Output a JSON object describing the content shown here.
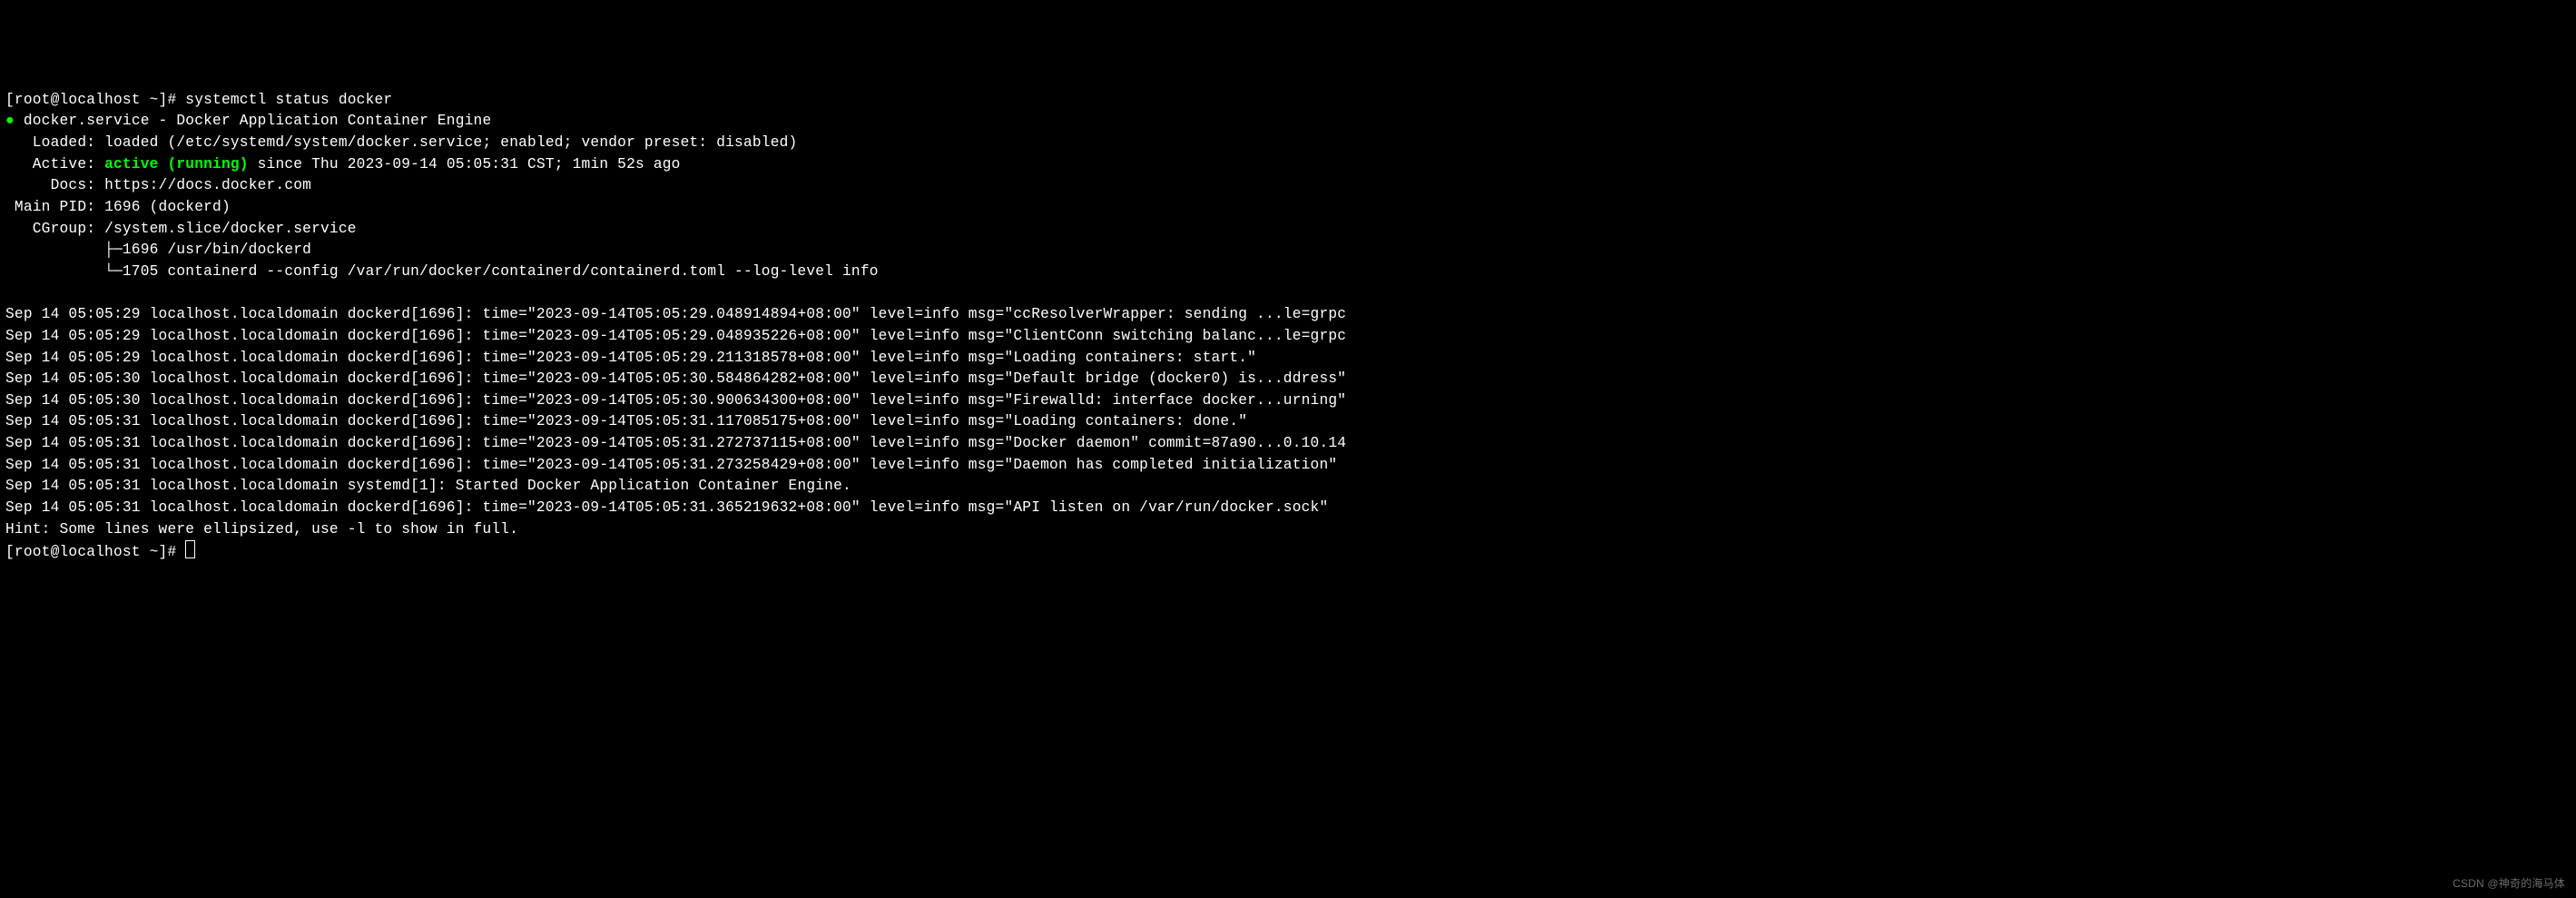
{
  "prompt1": "[root@localhost ~]# ",
  "command": "systemctl status docker",
  "service": {
    "bullet": "●",
    "name": "docker.service - Docker Application Container Engine",
    "loaded_label": "   Loaded: ",
    "loaded_value": "loaded (/etc/systemd/system/docker.service; enabled; vendor preset: disabled)",
    "active_label": "   Active: ",
    "active_state": "active (running)",
    "active_since": " since Thu 2023-09-14 05:05:31 CST; 1min 52s ago",
    "docs_label": "     Docs: ",
    "docs_value": "https://docs.docker.com",
    "mainpid_label": " Main PID: ",
    "mainpid_value": "1696 (dockerd)",
    "cgroup_label": "   CGroup: ",
    "cgroup_value": "/system.slice/docker.service",
    "cgroup_child1": "           ├─1696 /usr/bin/dockerd",
    "cgroup_child2": "           └─1705 containerd --config /var/run/docker/containerd/containerd.toml --log-level info"
  },
  "logs": [
    "Sep 14 05:05:29 localhost.localdomain dockerd[1696]: time=\"2023-09-14T05:05:29.048914894+08:00\" level=info msg=\"ccResolverWrapper: sending ...le=grpc",
    "Sep 14 05:05:29 localhost.localdomain dockerd[1696]: time=\"2023-09-14T05:05:29.048935226+08:00\" level=info msg=\"ClientConn switching balanc...le=grpc",
    "Sep 14 05:05:29 localhost.localdomain dockerd[1696]: time=\"2023-09-14T05:05:29.211318578+08:00\" level=info msg=\"Loading containers: start.\"",
    "Sep 14 05:05:30 localhost.localdomain dockerd[1696]: time=\"2023-09-14T05:05:30.584864282+08:00\" level=info msg=\"Default bridge (docker0) is...ddress\"",
    "Sep 14 05:05:30 localhost.localdomain dockerd[1696]: time=\"2023-09-14T05:05:30.900634300+08:00\" level=info msg=\"Firewalld: interface docker...urning\"",
    "Sep 14 05:05:31 localhost.localdomain dockerd[1696]: time=\"2023-09-14T05:05:31.117085175+08:00\" level=info msg=\"Loading containers: done.\"",
    "Sep 14 05:05:31 localhost.localdomain dockerd[1696]: time=\"2023-09-14T05:05:31.272737115+08:00\" level=info msg=\"Docker daemon\" commit=87a90...0.10.14",
    "Sep 14 05:05:31 localhost.localdomain dockerd[1696]: time=\"2023-09-14T05:05:31.273258429+08:00\" level=info msg=\"Daemon has completed initialization\"",
    "Sep 14 05:05:31 localhost.localdomain systemd[1]: Started Docker Application Container Engine.",
    "Sep 14 05:05:31 localhost.localdomain dockerd[1696]: time=\"2023-09-14T05:05:31.365219632+08:00\" level=info msg=\"API listen on /var/run/docker.sock\""
  ],
  "hint": "Hint: Some lines were ellipsized, use -l to show in full.",
  "prompt2": "[root@localhost ~]# ",
  "watermark": "CSDN @神奇的海马体"
}
